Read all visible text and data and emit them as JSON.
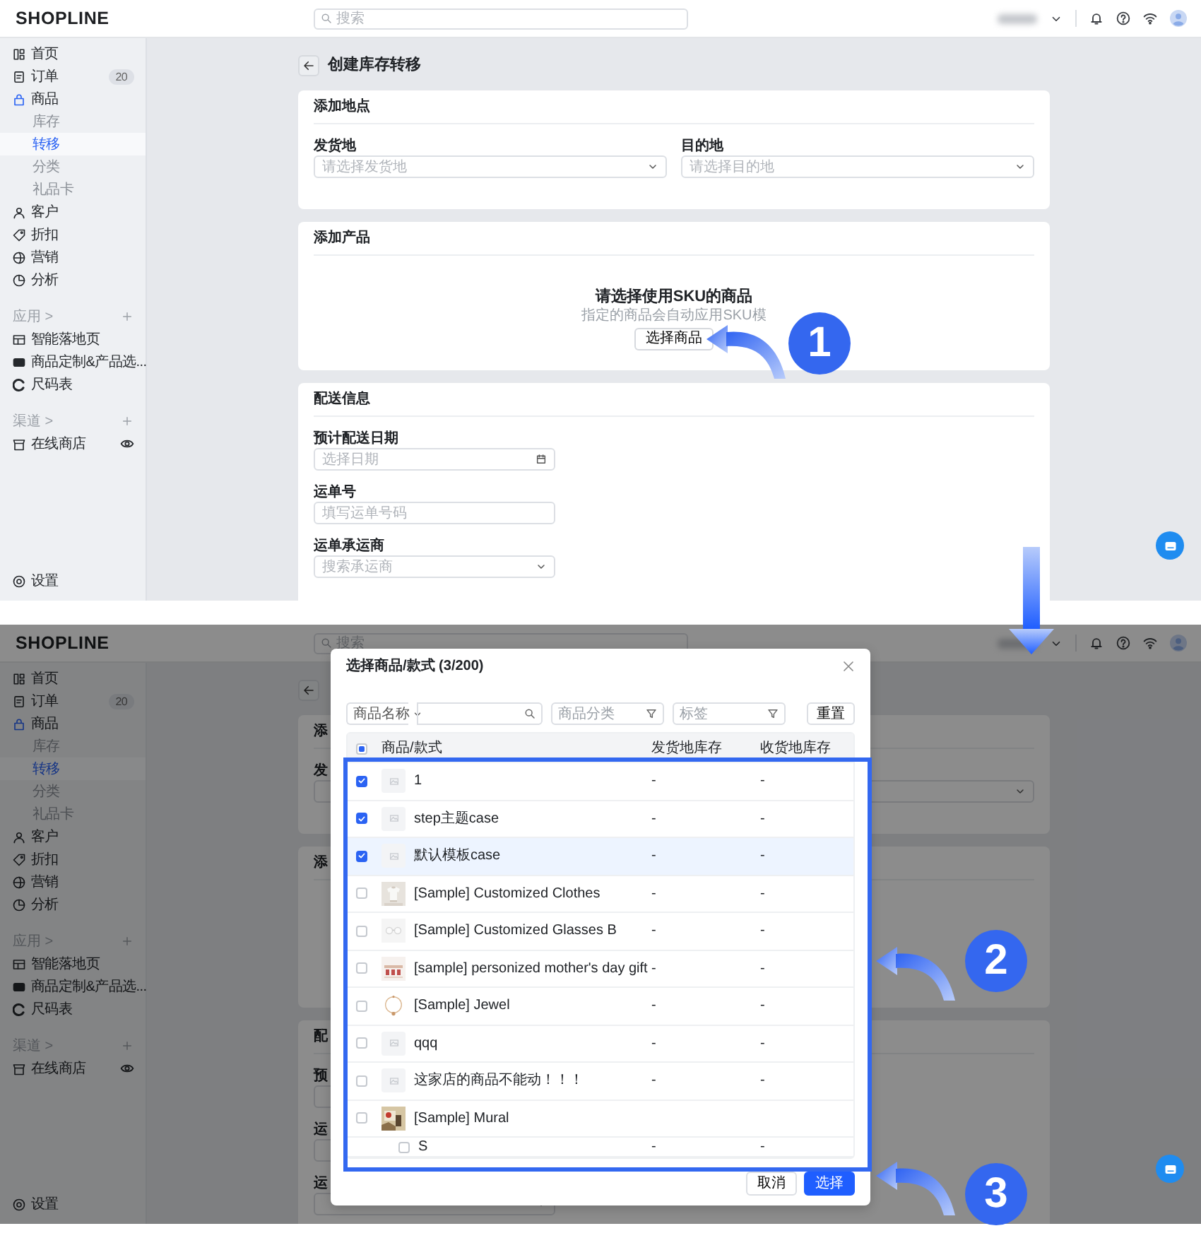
{
  "panels": [
    {
      "header": {
        "logo": "SHOPLINE",
        "search_placeholder": "搜索"
      },
      "sidebar": {
        "groups": [
          {
            "items": [
              {
                "label": "首页",
                "kind": "grid",
                "selected": false
              },
              {
                "label": "订单",
                "kind": "document",
                "selected": false,
                "badge": "20"
              },
              {
                "label": "商品",
                "kind": "bag",
                "selected": false,
                "expanded": true,
                "children": [
                  {
                    "label": "库存",
                    "selected": false
                  },
                  {
                    "label": "转移",
                    "selected": true
                  },
                  {
                    "label": "分类",
                    "selected": false
                  },
                  {
                    "label": "礼品卡",
                    "selected": false
                  }
                ]
              },
              {
                "label": "客户",
                "kind": "person",
                "selected": false
              },
              {
                "label": "折扣",
                "kind": "tag",
                "selected": false
              },
              {
                "label": "营销",
                "kind": "globe",
                "selected": false
              },
              {
                "label": "分析",
                "kind": "pie",
                "selected": false
              }
            ]
          },
          {
            "heading": "应用 >",
            "items": [
              {
                "label": "智能落地页",
                "kind": "layout",
                "selected": false
              },
              {
                "label": "商品定制&产品选...",
                "kind": "card",
                "selected": false
              },
              {
                "label": "尺码表",
                "kind": "arc",
                "selected": false
              }
            ]
          },
          {
            "heading": "渠道 >",
            "items": [
              {
                "label": "在线商店",
                "kind": "store",
                "selected": false,
                "visible": true
              }
            ]
          }
        ],
        "footer": {
          "label": "设置",
          "kind": "settings",
          "selected": false
        }
      },
      "page": {
        "title": "创建库存转移",
        "cards": [
          {
            "title": "添加地点",
            "kind": "columns",
            "fields": [
              {
                "label": "发货地",
                "kind": "select",
                "placeholder": "请选择发货地"
              },
              {
                "label": "目的地",
                "kind": "select",
                "placeholder": "请选择目的地"
              }
            ]
          },
          {
            "title": "添加产品",
            "kind": "empty",
            "empty_state": {
              "title": "请选择使用SKU的商品",
              "text": "指定的商品会自动应用SKU模",
              "button": "选择商品"
            }
          },
          {
            "title": "配送信息",
            "kind": "stack",
            "fields": [
              {
                "label": "预计配送日期",
                "kind": "date",
                "placeholder": "选择日期"
              },
              {
                "label": "运单号",
                "kind": "text",
                "placeholder": "填写运单号码"
              },
              {
                "label": "运单承运商",
                "kind": "select",
                "placeholder": "搜索承运商"
              }
            ]
          }
        ]
      }
    },
    {
      "header": {
        "logo": "SHOPLINE",
        "search_placeholder": "搜索"
      },
      "sidebar": {
        "groups": [
          {
            "items": [
              {
                "label": "首页",
                "kind": "grid",
                "selected": false
              },
              {
                "label": "订单",
                "kind": "document",
                "selected": false,
                "badge": "20"
              },
              {
                "label": "商品",
                "kind": "bag",
                "selected": false,
                "expanded": true,
                "children": [
                  {
                    "label": "库存",
                    "selected": false
                  },
                  {
                    "label": "转移",
                    "selected": true
                  },
                  {
                    "label": "分类",
                    "selected": false
                  },
                  {
                    "label": "礼品卡",
                    "selected": false
                  }
                ]
              },
              {
                "label": "客户",
                "kind": "person",
                "selected": false
              },
              {
                "label": "折扣",
                "kind": "tag",
                "selected": false
              },
              {
                "label": "营销",
                "kind": "globe",
                "selected": false
              },
              {
                "label": "分析",
                "kind": "pie",
                "selected": false
              }
            ]
          },
          {
            "heading": "应用 >",
            "items": [
              {
                "label": "智能落地页",
                "kind": "layout",
                "selected": false
              },
              {
                "label": "商品定制&产品选...",
                "kind": "card",
                "selected": false
              },
              {
                "label": "尺码表",
                "kind": "arc",
                "selected": false
              }
            ]
          },
          {
            "heading": "渠道 >",
            "items": [
              {
                "label": "在线商店",
                "kind": "store",
                "selected": false,
                "visible": true
              }
            ]
          }
        ],
        "footer": {
          "label": "设置",
          "kind": "settings",
          "selected": false
        }
      },
      "page": {
        "cards": [
          {
            "title": "添",
            "kind": "columns",
            "fields": [
              {
                "label": "发",
                "kind": "text"
              },
              {
                "kind": "select"
              }
            ]
          },
          {
            "title": "添",
            "kind": "empty"
          },
          {
            "title": "配",
            "kind": "stack",
            "fields": [
              {
                "label": "预",
                "kind": "text"
              },
              {
                "label": "运",
                "kind": "text"
              },
              {
                "label": "运",
                "kind": "select"
              }
            ]
          }
        ]
      },
      "modal": {
        "title": "选择商品/款式 (3/200)",
        "filters": {
          "field_select": "商品名称",
          "category_placeholder": "商品分类",
          "tag_placeholder": "标签",
          "reset": "重置"
        },
        "columns": [
          "商品/款式",
          "发货地库存",
          "收货地库存"
        ],
        "select_all": {
          "checked": false,
          "indeterminate": true
        },
        "rows": [
          {
            "kind": "placeholder",
            "name": "1",
            "checked": true,
            "hovered": false,
            "origin_stock": "-",
            "destination_stock": "-"
          },
          {
            "kind": "placeholder",
            "name": "step主题case",
            "checked": true,
            "hovered": false,
            "origin_stock": "-",
            "destination_stock": "-"
          },
          {
            "kind": "placeholder",
            "name": "默认模板case",
            "checked": true,
            "hovered": true,
            "origin_stock": "-",
            "destination_stock": "-"
          },
          {
            "kind": "picture",
            "name": "[Sample] Customized Clothes",
            "checked": false,
            "hovered": false,
            "origin_stock": "-",
            "destination_stock": "-"
          },
          {
            "kind": "picture",
            "name": "[Sample] Customized Glasses B",
            "checked": false,
            "hovered": false,
            "origin_stock": "-",
            "destination_stock": "-"
          },
          {
            "kind": "picture",
            "name": "[sample] personized mother's day gift",
            "checked": false,
            "hovered": false,
            "origin_stock": "-",
            "destination_stock": "-"
          },
          {
            "kind": "picture",
            "name": "[Sample] Jewel",
            "checked": false,
            "hovered": false,
            "origin_stock": "-",
            "destination_stock": "-"
          },
          {
            "kind": "placeholder",
            "name": "qqq",
            "checked": false,
            "hovered": false,
            "origin_stock": "-",
            "destination_stock": "-"
          },
          {
            "kind": "placeholder",
            "name": "这家店的商品不能动！！！",
            "checked": false,
            "hovered": false,
            "origin_stock": "-",
            "destination_stock": "-"
          },
          {
            "kind": "picture",
            "name": "[Sample] Mural",
            "checked": false,
            "hovered": false
          },
          {
            "kind": "variant",
            "name": "S",
            "checked": false,
            "hovered": false,
            "origin_stock": "-",
            "destination_stock": "-"
          }
        ],
        "buttons": [
          {
            "label": "取消",
            "kind": "secondary"
          },
          {
            "label": "选择",
            "kind": "primary"
          }
        ]
      }
    }
  ],
  "annotations": [
    {
      "label": "1"
    },
    {
      "label": "2"
    },
    {
      "label": "3"
    }
  ]
}
